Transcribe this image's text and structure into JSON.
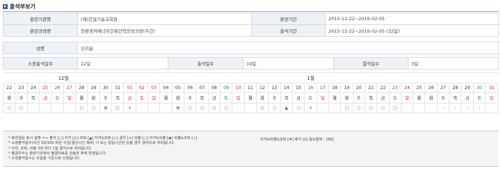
{
  "header": {
    "title": "출석부보기"
  },
  "info": {
    "org_label": "훈련기관명",
    "org_value": "(재)건설기술교육원",
    "period_label": "훈련기간",
    "period_value": "2015-12-22~2016-02-05",
    "course_label": "훈련과정명",
    "course_value": "친환경저에너지건축인력양성과정(주간)",
    "course_period_label": "출석기간",
    "course_period_value": "2015-12-22~2016-02-05 (32일)",
    "name_label": "성명",
    "name_value": "신지윤",
    "required_label": "소정출석일수",
    "required_value": "22일",
    "attend_label": "출석일수",
    "attend_value": "19일",
    "absent_label": "결석일수",
    "absent_value": "3일"
  },
  "attendance": {
    "months": [
      {
        "label": "12월",
        "span": 10
      },
      {
        "label": "1월",
        "span": 31
      }
    ],
    "days": [
      {
        "d": "22",
        "w": "화",
        "m": "○",
        "c": ""
      },
      {
        "d": "23",
        "w": "수",
        "m": "○",
        "c": ""
      },
      {
        "d": "24",
        "w": "목",
        "m": "",
        "c": ""
      },
      {
        "d": "25",
        "w": "금",
        "m": "",
        "c": "red"
      },
      {
        "d": "26",
        "w": "토",
        "m": "",
        "c": "green"
      },
      {
        "d": "27",
        "w": "일",
        "m": "",
        "c": "red"
      },
      {
        "d": "28",
        "w": "월",
        "m": "○",
        "c": ""
      },
      {
        "d": "29",
        "w": "화",
        "m": "○",
        "c": ""
      },
      {
        "d": "30",
        "w": "수",
        "m": "✿",
        "c": ""
      },
      {
        "d": "31",
        "w": "목",
        "m": "○",
        "c": ""
      },
      {
        "d": "01",
        "w": "금",
        "m": "×",
        "c": "red"
      },
      {
        "d": "02",
        "w": "토",
        "m": "",
        "c": "red"
      },
      {
        "d": "03",
        "w": "일",
        "m": "",
        "c": "red"
      },
      {
        "d": "04",
        "w": "월",
        "m": "",
        "c": ""
      },
      {
        "d": "05",
        "w": "화",
        "m": "✿",
        "c": ""
      },
      {
        "d": "06",
        "w": "수",
        "m": "○",
        "c": ""
      },
      {
        "d": "07",
        "w": "목",
        "m": "○",
        "c": ""
      },
      {
        "d": "08",
        "w": "금",
        "m": "○",
        "c": ""
      },
      {
        "d": "09",
        "w": "토",
        "m": "○",
        "c": "green"
      },
      {
        "d": "10",
        "w": "일",
        "m": "",
        "c": "red"
      },
      {
        "d": "11",
        "w": "월",
        "m": "",
        "c": ""
      },
      {
        "d": "12",
        "w": "화",
        "m": "○",
        "c": ""
      },
      {
        "d": "13",
        "w": "수",
        "m": "○",
        "c": ""
      },
      {
        "d": "14",
        "w": "목",
        "m": "▲",
        "c": ""
      },
      {
        "d": "15",
        "w": "금",
        "m": "○",
        "c": ""
      },
      {
        "d": "16",
        "w": "토",
        "m": "×",
        "c": "green"
      },
      {
        "d": "17",
        "w": "일",
        "m": "",
        "c": "red"
      },
      {
        "d": "18",
        "w": "월",
        "m": "",
        "c": ""
      },
      {
        "d": "19",
        "w": "화",
        "m": "○",
        "c": ""
      },
      {
        "d": "20",
        "w": "수",
        "m": "○",
        "c": ""
      },
      {
        "d": "21",
        "w": "목",
        "m": "○",
        "c": ""
      },
      {
        "d": "22",
        "w": "금",
        "m": "○",
        "c": ""
      },
      {
        "d": "23",
        "w": "토",
        "m": "○",
        "c": "green"
      },
      {
        "d": "24",
        "w": "일",
        "m": "",
        "c": "red"
      },
      {
        "d": "25",
        "w": "월",
        "m": "",
        "c": ""
      },
      {
        "d": "26",
        "w": "화",
        "m": "",
        "c": ""
      },
      {
        "d": "27",
        "w": "수",
        "m": "-",
        "c": ""
      },
      {
        "d": "28",
        "w": "목",
        "m": "-",
        "c": ""
      },
      {
        "d": "29",
        "w": "금",
        "m": "-",
        "c": ""
      },
      {
        "d": "30",
        "w": "토",
        "m": "-",
        "c": "green"
      },
      {
        "d": "31",
        "w": "일",
        "m": "",
        "c": "red"
      }
    ]
  },
  "notes": {
    "items": [
      "휴연생상 표시 설명 => 출석 [○] 지각 [◎] 조퇴 [▲] 지각&조퇴 [◇] 결석 [×] 외출 [○] 지각&외출 [◆] 외출&조퇴 [◇]",
      "소정출석일수(지간 50/100 미만 수업(결강시간 제외) 시 또는 일일시간만 있을 경우 결석으로 처리됩니다.",
      "지각, 조퇴, 외출 3회 마다 1일 결석으로 처리됩니다.",
      "출결우두는 훈련기관에서 출결자료를 전송한 후에 반영됩니다.",
      "소정출석일수는 오늘을 기준으로 산정됩니다."
    ],
    "right": "지각&외출&조퇴 [#] 휴가 [2] 중도탈락 : [99]"
  }
}
